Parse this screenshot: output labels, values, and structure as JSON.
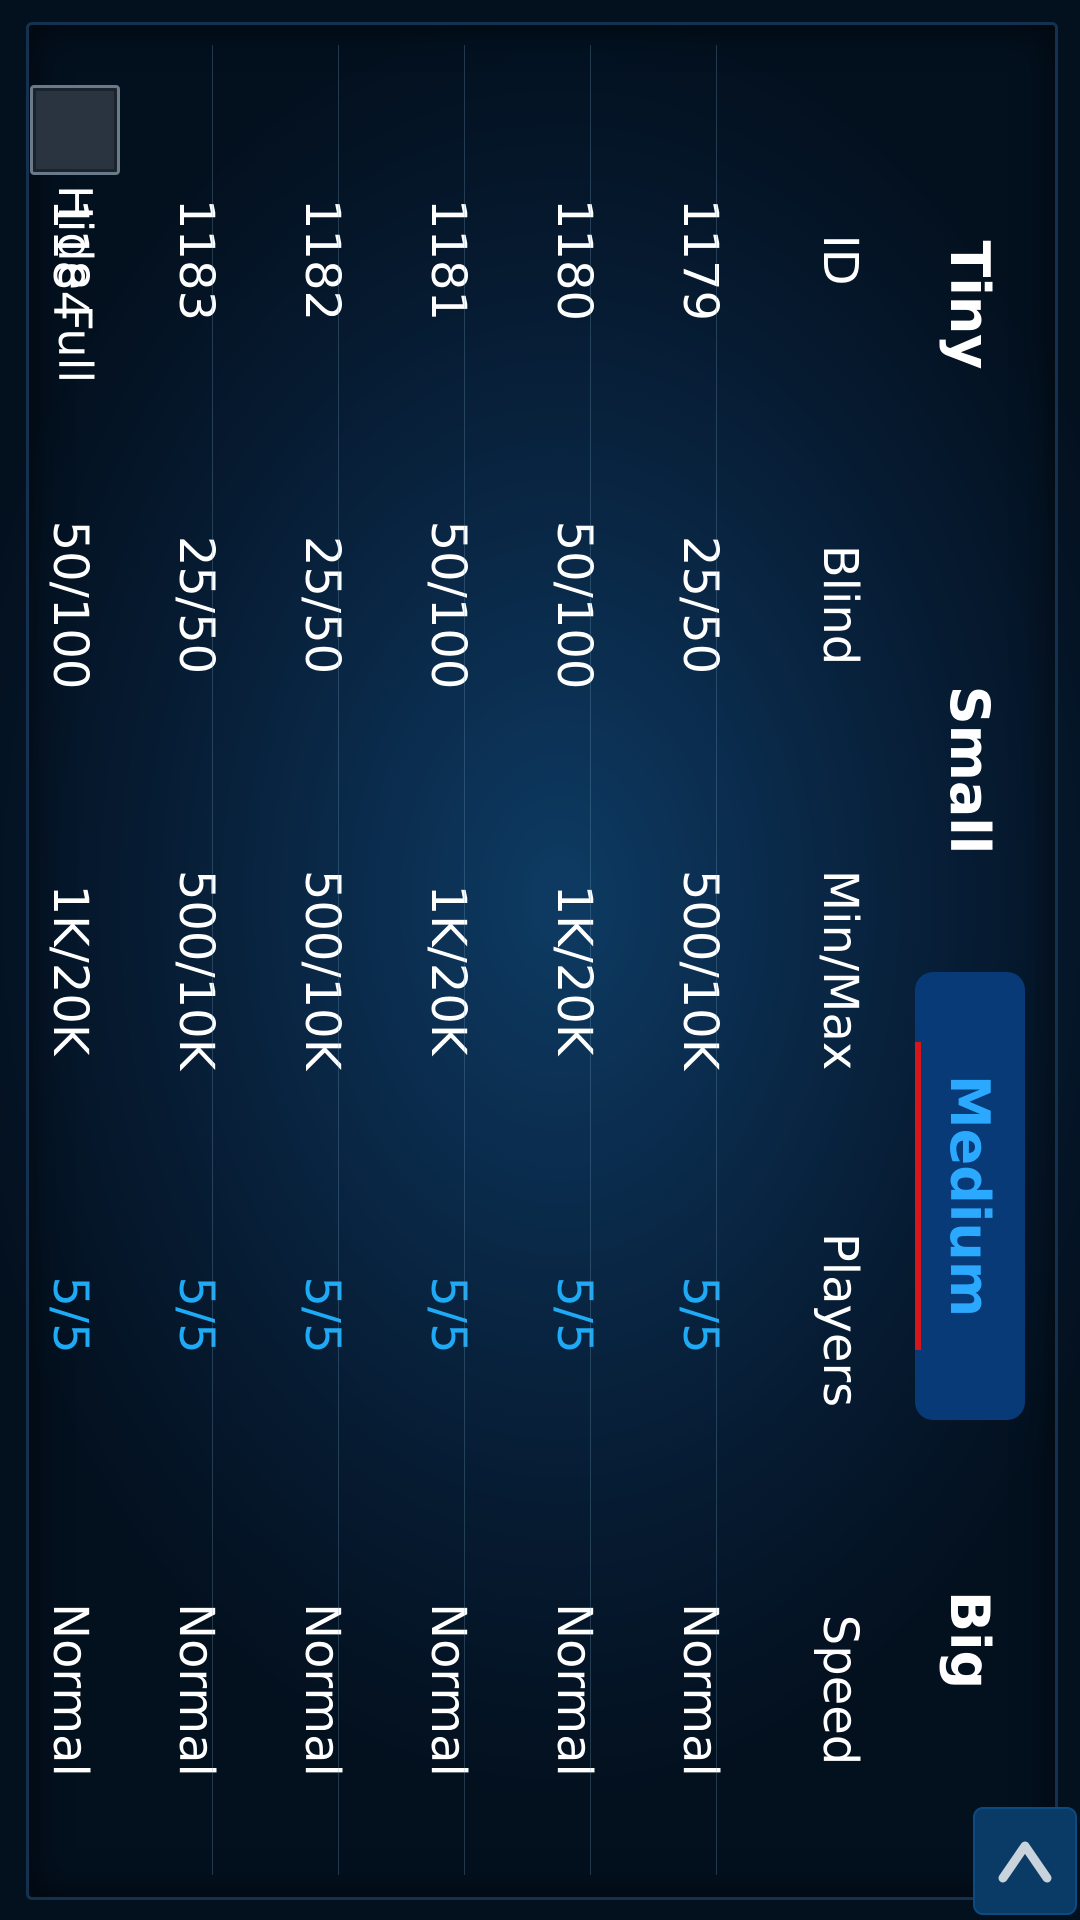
{
  "tabs": [
    {
      "label": "Tiny",
      "active": false
    },
    {
      "label": "Small",
      "active": false
    },
    {
      "label": "Medium",
      "active": true
    },
    {
      "label": "Big",
      "active": false
    }
  ],
  "columns": [
    "ID",
    "Blind",
    "Min/Max",
    "Players",
    "Speed"
  ],
  "rows": [
    {
      "id": "1179",
      "blind": "25/50",
      "minmax": "500/10K",
      "players": "5/5",
      "speed": "Normal"
    },
    {
      "id": "1180",
      "blind": "50/100",
      "minmax": "1K/20K",
      "players": "5/5",
      "speed": "Normal"
    },
    {
      "id": "1181",
      "blind": "50/100",
      "minmax": "1K/20K",
      "players": "5/5",
      "speed": "Normal"
    },
    {
      "id": "1182",
      "blind": "25/50",
      "minmax": "500/10K",
      "players": "5/5",
      "speed": "Normal"
    },
    {
      "id": "1183",
      "blind": "25/50",
      "minmax": "500/10K",
      "players": "5/5",
      "speed": "Normal"
    },
    {
      "id": "1184",
      "blind": "50/100",
      "minmax": "1K/20K",
      "players": "5/5",
      "speed": "Normal"
    }
  ],
  "hide_full": {
    "label": "Hide Full",
    "checked": false
  },
  "scroll_button": {
    "icon": "chevron-up-icon"
  },
  "colors": {
    "accent": "#2aa9ff",
    "active_tab_bg": "#083a78",
    "active_tab_underline": "#d6161b",
    "players_text": "#1eaaf5"
  }
}
